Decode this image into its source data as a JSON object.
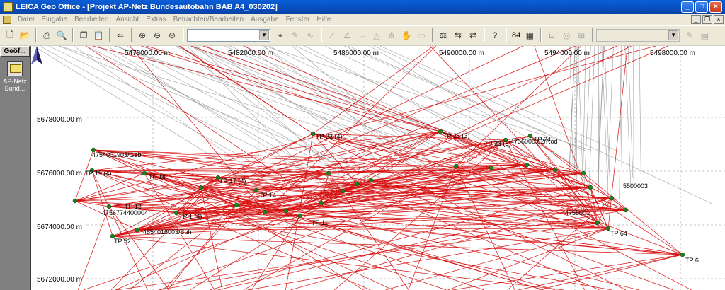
{
  "window": {
    "title": "LEICA Geo Office - [Projekt AP-Netz Bundesautobahn BAB A4_030202]"
  },
  "menu": {
    "items": [
      "Datei",
      "Eingabe",
      "Bearbeiten",
      "Ansicht",
      "Extras",
      "Betrachten/Bearbeiten",
      "Ausgabe",
      "Fenster",
      "Hilfe"
    ]
  },
  "toolbar": {
    "count_label": "84",
    "view_combo_value": "",
    "filter_combo_value": ""
  },
  "left_panel": {
    "header": "Geöf...",
    "project_label_1": "AP-Netz",
    "project_label_2": "Bund..."
  },
  "map": {
    "x_labels": [
      "5478000.00 m",
      "5482000.00 m",
      "5486000.00 m",
      "5490000.00 m",
      "5494000.00 m",
      "5498000.00 m"
    ],
    "y_labels": [
      "5678000.00 m",
      "5676000.00 m",
      "5674000.00 m",
      "5672000.00 m"
    ],
    "point_labels": [
      {
        "id": "tp23",
        "text": "TP 23 (4)"
      },
      {
        "id": "tp25",
        "text": "TP 25 (3)"
      },
      {
        "id": "tp24",
        "text": "TP 24"
      },
      {
        "id": "tp23b",
        "text": "TP 23 (5)"
      },
      {
        "id": "rod",
        "text": "4756000.02/Rod"
      },
      {
        "id": "geb",
        "text": "4754001903/Geb"
      },
      {
        "id": "tp19",
        "text": "TP 19 (4)"
      },
      {
        "id": "tp18",
        "text": "TP 18"
      },
      {
        "id": "tp17",
        "text": "TP 17 (4)"
      },
      {
        "id": "tp14",
        "text": "TP 14"
      },
      {
        "id": "tp12",
        "text": "TP 12"
      },
      {
        "id": "p4756",
        "text": "4756774400004"
      },
      {
        "id": "tp1",
        "text": "TP 1 (4)"
      },
      {
        "id": "buh",
        "text": "4854016003/Buh"
      },
      {
        "id": "tp52",
        "text": "TP 52"
      },
      {
        "id": "tp11",
        "text": "TP 11"
      },
      {
        "id": "tp64",
        "text": "TP 64"
      },
      {
        "id": "tp6",
        "text": "TP 6"
      },
      {
        "id": "p500003",
        "text": "5500003"
      },
      {
        "id": "p4755",
        "text": "4755001"
      }
    ]
  },
  "colors": {
    "network_line": "#d81010",
    "ref_line": "#a0a0a0",
    "point_fill": "#208020",
    "grid": "#909090"
  }
}
